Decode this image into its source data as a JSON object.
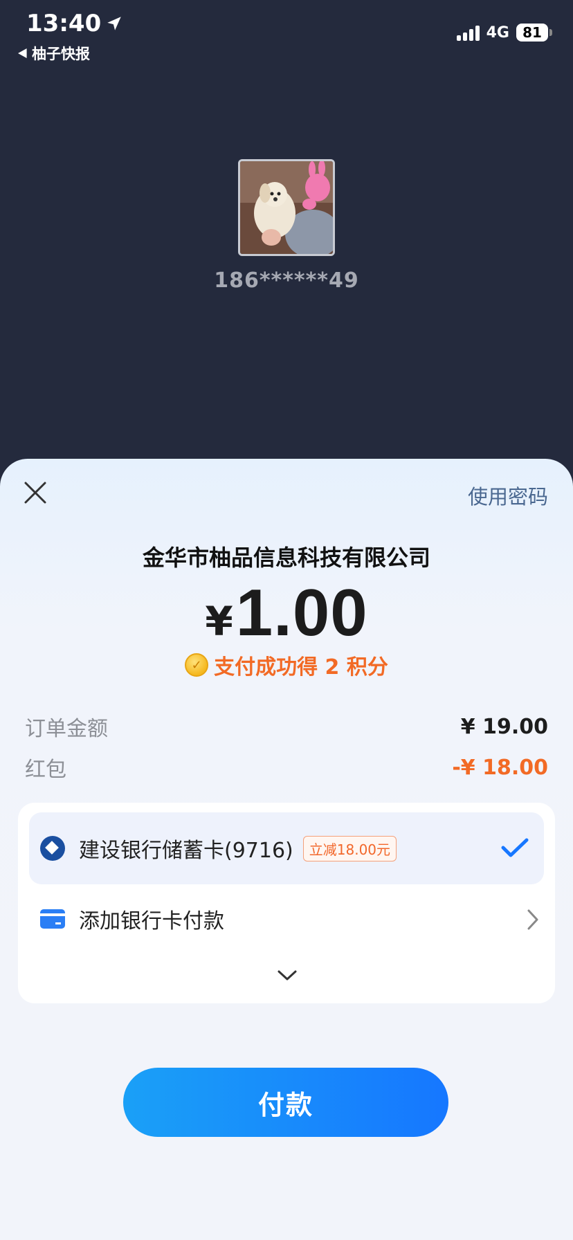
{
  "status_bar": {
    "time": "13:40",
    "back_app": "柚子快报",
    "network": "4G",
    "battery": "81"
  },
  "payee": {
    "phone_masked": "186******49"
  },
  "sheet": {
    "use_password_label": "使用密码",
    "merchant_name": "金华市柚品信息科技有限公司",
    "currency_symbol": "¥",
    "amount": "1.00",
    "points_text": "支付成功得 2 积分",
    "order_amount_label": "订单金额",
    "order_amount_value": "¥ 19.00",
    "red_packet_label": "红包",
    "red_packet_value": "-¥ 18.00"
  },
  "payment_methods": {
    "selected_card": "建设银行储蓄卡(9716)",
    "discount_tag": "立减18.00元",
    "add_card_label": "添加银行卡付款"
  },
  "pay_button_label": "付款",
  "colors": {
    "accent_blue": "#1677ff",
    "discount_orange": "#f26a25",
    "header_bg": "#242a3d"
  }
}
